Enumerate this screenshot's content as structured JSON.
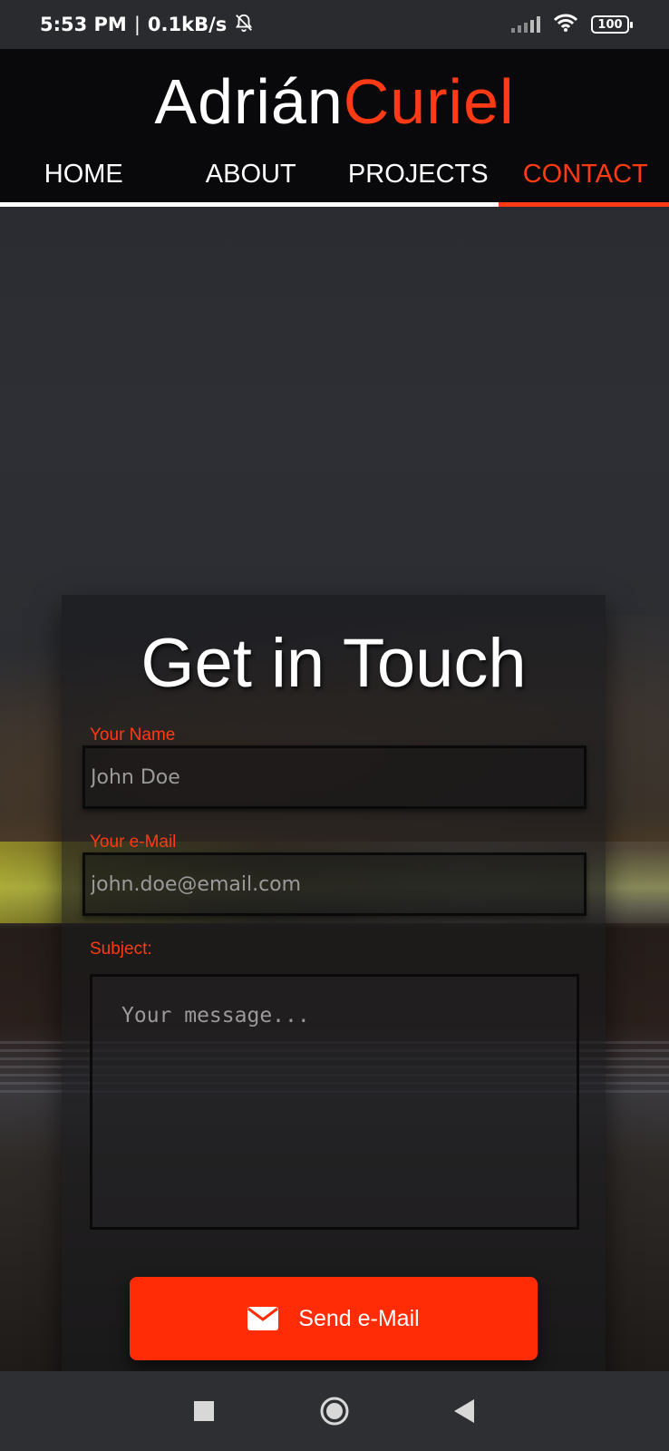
{
  "status_bar": {
    "time": "5:53 PM",
    "separator": "|",
    "speed": "0.1kB/s",
    "battery": "100"
  },
  "header": {
    "logo_first": "Adrián",
    "logo_last": "Curiel",
    "nav": [
      {
        "label": "HOME",
        "active": false
      },
      {
        "label": "ABOUT",
        "active": false
      },
      {
        "label": "PROJECTS",
        "active": false
      },
      {
        "label": "CONTACT",
        "active": true
      }
    ]
  },
  "contact": {
    "title": "Get in Touch",
    "name_label": "Your Name",
    "name_placeholder": "John Doe",
    "email_label": "Your e-Mail",
    "email_placeholder": "john.doe@email.com",
    "subject_label": "Subject:",
    "message_placeholder": "Your message...",
    "send_label": "Send e-Mail"
  },
  "colors": {
    "accent": "#ff3a14",
    "button": "#ff2c06",
    "header_bg": "#09090b"
  },
  "icons": {
    "status": [
      "bell-off-icon",
      "signal-icon",
      "wifi-icon",
      "battery-icon"
    ],
    "send": "envelope-icon",
    "system_nav": [
      "recents-square-icon",
      "home-circle-icon",
      "back-triangle-icon"
    ]
  }
}
